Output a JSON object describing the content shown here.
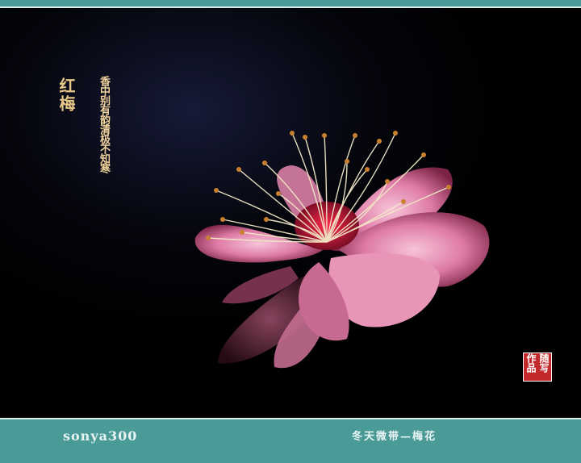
{
  "poem": {
    "title": "红梅",
    "verse": "香中别有韵清极不知寒"
  },
  "seal": {
    "text": "随写作品"
  },
  "footer": {
    "author": "sonya300",
    "caption": "冬天微带—梅花"
  },
  "colors": {
    "band": "#4a9a98",
    "petal": "#e58ab0",
    "text_gold": "#f0d39a",
    "seal": "#c3282a"
  }
}
